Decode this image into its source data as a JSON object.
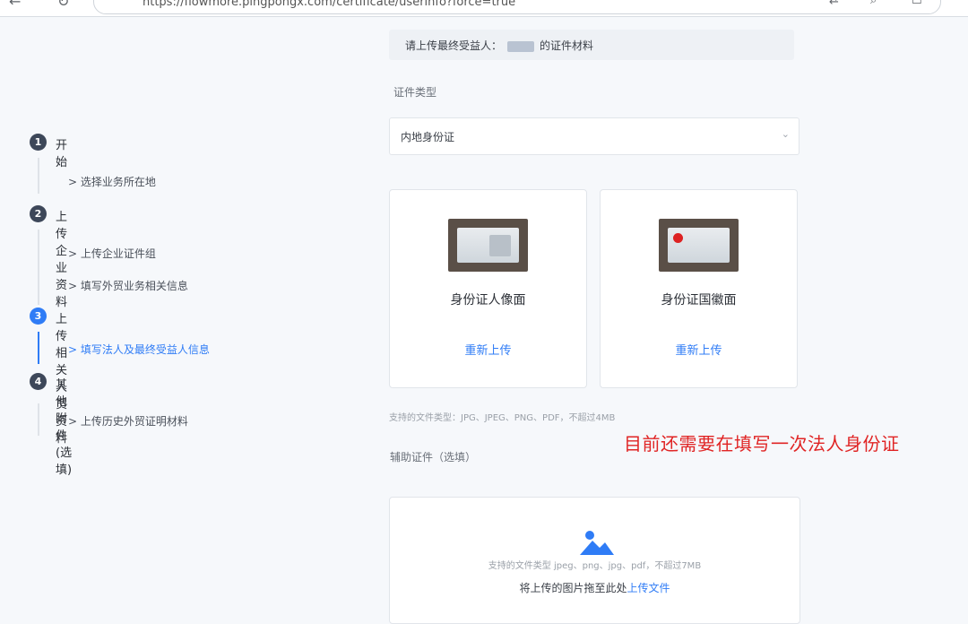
{
  "browser": {
    "url": "https://flowmore.pingpongx.com/certificate/userinfo?force=true",
    "back_icon": "back-arrow-icon",
    "reload_icon": "reload-icon"
  },
  "sidebar": {
    "steps": [
      {
        "number": "1",
        "title": "开始",
        "items": [
          "> 选择业务所在地"
        ]
      },
      {
        "number": "2",
        "title": "上传企业资料",
        "items": [
          "> 上传企业证件组",
          "> 填写外贸业务相关信息"
        ]
      },
      {
        "number": "3",
        "title": "上传相关人员资料",
        "items": [
          "> 填写法人及最终受益人信息"
        ]
      },
      {
        "number": "4",
        "title": "其他附件 (选填)",
        "items": [
          "> 上传历史外贸证明材料"
        ]
      }
    ],
    "active_step": 3,
    "active_color": "#2f7cf6"
  },
  "main": {
    "notice_prefix": "请上传最终受益人：",
    "notice_suffix": "的证件材料",
    "id_type_label": "证件类型",
    "id_type_value": "内地身份证",
    "cards": [
      {
        "title": "身份证人像面",
        "action": "重新上传"
      },
      {
        "title": "身份证国徽面",
        "action": "重新上传"
      }
    ],
    "file_hint": "支持的文件类型：JPG、JPEG、PNG、PDF，不超过4MB",
    "annotation": "目前还需要在填写一次法人身份证",
    "supporting_label": "辅助证件（选填）",
    "dropzone_types": "支持的文件类型  jpeg、png、jpg、pdf，不超过7MB",
    "dropzone_text": "将上传的图片拖至此处",
    "dropzone_link": "上传文件"
  },
  "colors": {
    "accent": "#2f7cf6",
    "annotation": "#e02424",
    "step_dark": "#3d4759"
  }
}
